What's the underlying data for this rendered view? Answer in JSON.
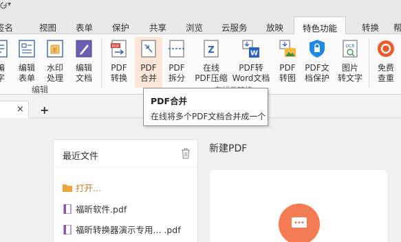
{
  "titlebar": {
    "caret": "▾"
  },
  "tabs": [
    {
      "label": "签名"
    },
    {
      "label": "视图"
    },
    {
      "label": "表单"
    },
    {
      "label": "保护"
    },
    {
      "label": "共享"
    },
    {
      "label": "浏览"
    },
    {
      "label": "云服务"
    },
    {
      "label": "放映"
    },
    {
      "label": "特色功能",
      "active": true
    },
    {
      "label": "转换"
    },
    {
      "label": "帮"
    }
  ],
  "ribbon": {
    "buttons": [
      {
        "label": "编\n字",
        "icon": "edit-text-icon"
      },
      {
        "label": "编辑\n表单",
        "icon": "edit-form-icon"
      },
      {
        "label": "水印\n处理",
        "icon": "watermark-icon"
      },
      {
        "label": "编辑\n文档",
        "icon": "edit-document-icon"
      },
      {
        "label": "PDF\n转换",
        "icon": "pdf-convert-icon"
      },
      {
        "label": "PDF\n合并",
        "icon": "pdf-merge-icon"
      },
      {
        "label": "PDF\n拆分",
        "icon": "pdf-split-icon"
      },
      {
        "label": "在线\nPDF压缩",
        "icon": "pdf-compress-icon"
      },
      {
        "label": "PDF转\nWord文档",
        "icon": "pdf-to-word-icon"
      },
      {
        "label": "PDF\n转图",
        "icon": "pdf-to-image-icon"
      },
      {
        "label": "PDF文\n档保护",
        "icon": "pdf-protect-icon"
      },
      {
        "label": "图片\n转文字",
        "icon": "ocr-icon"
      },
      {
        "label": "免费\n查重",
        "icon": "plagiarism-check-icon"
      }
    ],
    "group_label_edit": "编辑",
    "group_label_online_partial": "在线云转换"
  },
  "tooltip": {
    "title": "PDF合并",
    "description": "在线将多个PDF文档合并成一个"
  },
  "doctabs": {
    "close": "×",
    "add": "+"
  },
  "recent": {
    "title": "最近文件",
    "open_label": "打开...",
    "files": [
      {
        "name": "福昕软件.pdf"
      },
      {
        "name": "福昕转换器演示专用...  .pdf"
      }
    ]
  },
  "new_pdf": {
    "title": "新建PDF"
  },
  "colors": {
    "accent": "#f47c52",
    "highlight": "#fde6d8",
    "pdf_red": "#d9463b",
    "word_blue": "#2b63c5"
  }
}
